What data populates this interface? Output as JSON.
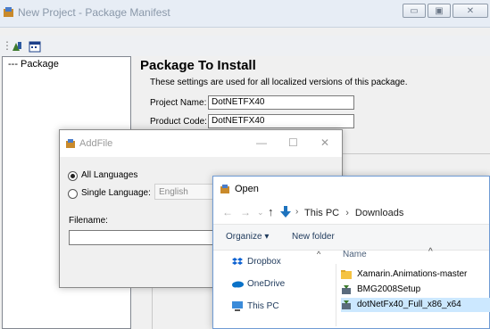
{
  "main_window": {
    "title": "New Project - Package Manifest",
    "controls": [
      "minimize",
      "maximize",
      "close"
    ]
  },
  "toolbar": {
    "icons": [
      "add-file-icon",
      "calendar-icon"
    ]
  },
  "tree": {
    "items": [
      {
        "label": "--- Package"
      }
    ]
  },
  "package": {
    "heading": "Package To Install",
    "description": "These settings are used for all localized versions of this package.",
    "project_name_label": "Project Name:",
    "project_name_value": "DotNETFX40",
    "product_code_label": "Product Code:",
    "product_code_value": "DotNETFX40"
  },
  "addfile": {
    "title": "AddFile",
    "min_glyph": "—",
    "max_glyph": "☐",
    "close_glyph": "✕",
    "all_languages": "All Languages",
    "all_languages_selected": true,
    "single_language": "Single Language:",
    "language_value": "English",
    "filename_label": "Filename:",
    "filename_value": ""
  },
  "open": {
    "title": "Open",
    "path": [
      "This PC",
      "Downloads"
    ],
    "organize": "Organize ▾",
    "new_folder": "New folder",
    "column_name": "Name",
    "nav_items": [
      {
        "label": "Dropbox",
        "icon": "dropbox-icon",
        "color": "#0d62d1"
      },
      {
        "label": "OneDrive",
        "icon": "onedrive-icon",
        "color": "#0a72c8"
      },
      {
        "label": "This PC",
        "icon": "computer-icon",
        "color": "#3b8bd9"
      }
    ],
    "files": [
      {
        "label": "Xamarin.Animations-master",
        "icon": "folder-icon",
        "selected": false
      },
      {
        "label": "BMG2008Setup",
        "icon": "installer-icon",
        "selected": false
      },
      {
        "label": "dotNetFx40_Full_x86_x64",
        "icon": "installer-icon",
        "selected": true
      }
    ]
  },
  "colors": {
    "accent": "#1e73be",
    "selection": "#cce8ff",
    "folder": "#f5c342"
  }
}
